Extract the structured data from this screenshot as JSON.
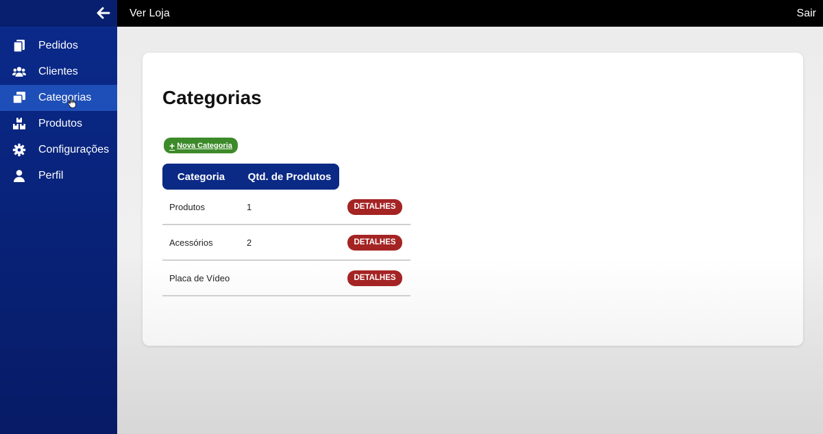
{
  "topbar": {
    "link_label": "Ver Loja",
    "logout_label": "Sair"
  },
  "sidebar": {
    "back_icon": "arrow-left-icon",
    "items": [
      {
        "label": "Pedidos",
        "icon": "documents-icon",
        "active": false
      },
      {
        "label": "Clientes",
        "icon": "users-icon",
        "active": false
      },
      {
        "label": "Categorias",
        "icon": "categories-icon",
        "active": true
      },
      {
        "label": "Produtos",
        "icon": "boxes-icon",
        "active": false
      },
      {
        "label": "Configurações",
        "icon": "gear-icon",
        "active": false
      },
      {
        "label": "Perfil",
        "icon": "user-icon",
        "active": false
      }
    ]
  },
  "main": {
    "title": "Categorias",
    "new_button_label": "Nova Categoria",
    "table": {
      "headers": [
        "Categoria",
        "Qtd. de Produtos"
      ],
      "rows": [
        {
          "category": "Produtos",
          "qty": "1",
          "action": "DETALHES"
        },
        {
          "category": "Acessórios",
          "qty": "2",
          "action": "DETALHES"
        },
        {
          "category": "Placa de Vídeo",
          "qty": "",
          "action": "DETALHES"
        }
      ]
    }
  },
  "colors": {
    "sidebar_bg": "#082175",
    "active_item": "#1e4fb8",
    "topbar_bg": "#000000",
    "table_header": "#0b2a86",
    "new_button": "#3d8a2a",
    "details_button": "#a42424"
  }
}
